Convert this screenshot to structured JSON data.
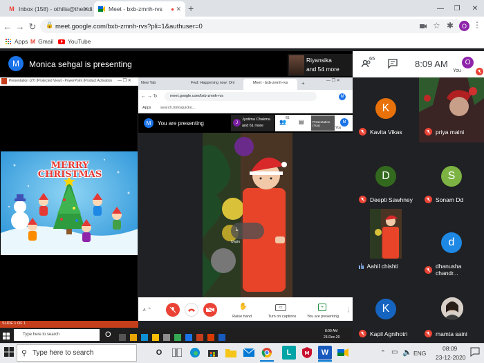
{
  "browser": {
    "tabs": [
      {
        "label": "Inbox (158) - othilia@theindiansc",
        "icon": "gmail-icon"
      },
      {
        "label": "Meet - bxb-zmnh-rvs",
        "icon": "meet-icon"
      }
    ],
    "url": "meet.google.com/bxb-zmnh-rvs?pli=1&authuser=0",
    "bookmarks": [
      "Apps",
      "Gmail",
      "YouTube"
    ],
    "profile_initial": "O"
  },
  "meet": {
    "presenter_initial": "M",
    "presenting_label": "Monica sehgal is presenting",
    "viewer": {
      "name": "Riyansika",
      "more": "and 54 more"
    },
    "participant_count": "65",
    "time": "8:09 AM",
    "you_label": "You",
    "you_initial": "O"
  },
  "shared_screen": {
    "ppt_title": "Presentation (27) [Protected View] - PowerPoint (Product Activation Failed)",
    "slide_title": "MERRY CHRISTMAS",
    "slide_status": "SLIDE 1 OF 1",
    "inner_tabs": [
      "New Tab",
      "Fwd: Happening now: Onl",
      "Meet - bxb-zmnh-rvs"
    ],
    "inner_url": "meet.google.com/bxb-zmnh-rvs",
    "inner_bookmark": "Apps",
    "inner_search": "search.mmyquicko...",
    "inner_presenting": "You are presenting",
    "inner_viewer": {
      "initial": "J",
      "name": "Jyotima Chakma",
      "more": "and 61 more"
    },
    "inner_count": "65",
    "inner_presentation_label": "Presentation (You)",
    "inner_you": "You",
    "unpin_label": "Unpin",
    "controls": [
      {
        "label": "Raise hand"
      },
      {
        "label": "Turn on captions"
      },
      {
        "label": "You are presenting"
      }
    ],
    "inner_taskbar_search": "Type here to search",
    "inner_time": "8:09 AM",
    "inner_date": "23-Dec-20"
  },
  "participants": [
    {
      "name": "Kavita Vikas",
      "initial": "K",
      "color": "#e8710a",
      "type": "avatar"
    },
    {
      "name": "priya maini",
      "initial": "",
      "color": "#5c2a2a",
      "type": "video"
    },
    {
      "name": "Deepti Sawhney",
      "initial": "D",
      "color": "#33691e",
      "type": "avatar"
    },
    {
      "name": "Sonam Dd",
      "initial": "S",
      "color": "#7cb342",
      "type": "avatar"
    },
    {
      "name": "Aahil chishti",
      "initial": "",
      "color": "#3a3a3a",
      "type": "video"
    },
    {
      "name": "dhanusha chandr...",
      "initial": "d",
      "color": "#1e88e5",
      "type": "avatar"
    },
    {
      "name": "Kapil Agnihotri",
      "initial": "K",
      "color": "#1565c0",
      "type": "avatar"
    },
    {
      "name": "mamta saini",
      "initial": "",
      "color": "#444",
      "type": "photo"
    }
  ],
  "taskbar": {
    "search_placeholder": "Type here to search",
    "language": "ENG",
    "time": "08:09",
    "date": "23-12-2020"
  }
}
